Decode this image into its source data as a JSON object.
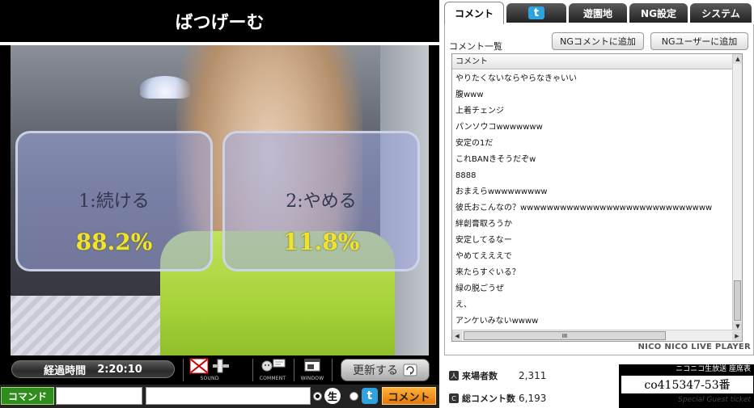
{
  "title": "ばつげーむ",
  "vote": {
    "option1": {
      "label": "1:続ける",
      "percent": "88.2%"
    },
    "option2": {
      "label": "2:やめる",
      "percent": "11.8%"
    }
  },
  "controls": {
    "elapsed_label": "経過時間",
    "elapsed_value": "2:20:10",
    "sound_label": "SOUND",
    "comment_label": "COMMENT",
    "window_label": "WINDOW",
    "refresh_label": "更新する"
  },
  "command_row": {
    "command_label": "コマンド",
    "live_badge": "生",
    "twitter_badge": "t",
    "comment_button": "コメント"
  },
  "tabs": [
    {
      "label": "コメント",
      "active": true
    },
    {
      "label": "t",
      "icon": "twitter-icon",
      "active": false
    },
    {
      "label": "遊園地",
      "active": false
    },
    {
      "label": "NG設定",
      "active": false
    },
    {
      "label": "システム",
      "active": false
    }
  ],
  "comments_panel": {
    "list_title": "コメント一覧",
    "ng_comment_button": "NGコメントに追加",
    "ng_user_button": "NGユーザーに追加",
    "column_header": "コメント",
    "brand": "NICO NICO LIVE PLAYER",
    "rows": [
      "やりたくないならやらなきゃいい",
      "腹www",
      "上着チェンジ",
      "パンソウコwwwwwww",
      "安定の1だ",
      "これBANきそうだぞw",
      "8888",
      "おまえらwwwwwwwww",
      "彼氏おこんなの？wwwwwwwwwwwwwwwwwwwwwwwwwwwww",
      "絆創膏取ろうか",
      "安定してるなー",
      "やめてえええで",
      "来たらすぐいる？",
      "緑の脱ごうぜ",
      "え、",
      "アンケいみないwwww"
    ]
  },
  "stats": {
    "visitors_label": "来場者数",
    "visitors_value": "2,311",
    "comments_label": "総コメント数",
    "comments_value": "6,193"
  },
  "community": {
    "header": "ニコニコ生放送 座席表",
    "seat": "co415347-53番",
    "sub": "Special Guest ticket"
  },
  "colors": {
    "vote_percent": "#f1e32c",
    "command_green": "#2f8d1c",
    "comment_orange": "#e5770a",
    "twitter_blue": "#2fa3e0"
  }
}
